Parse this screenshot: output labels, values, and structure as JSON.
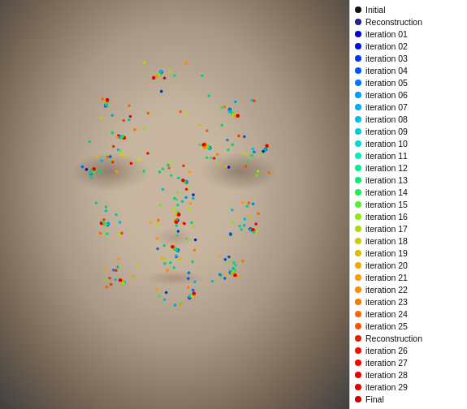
{
  "legend": {
    "items": [
      {
        "label": "Initial",
        "color": "#111111"
      },
      {
        "label": "Reconstruction",
        "color": "#222288"
      },
      {
        "label": "iteration 01",
        "color": "#0000cc"
      },
      {
        "label": "iteration 02",
        "color": "#0011dd"
      },
      {
        "label": "iteration 03",
        "color": "#0033ee"
      },
      {
        "label": "iteration 04",
        "color": "#0055ff"
      },
      {
        "label": "iteration 05",
        "color": "#0077ff"
      },
      {
        "label": "iteration 06",
        "color": "#0099ff"
      },
      {
        "label": "iteration 07",
        "color": "#00aaff"
      },
      {
        "label": "iteration 08",
        "color": "#00bbee"
      },
      {
        "label": "iteration 09",
        "color": "#00ccdd"
      },
      {
        "label": "iteration 10",
        "color": "#00ddcc"
      },
      {
        "label": "iteration 11",
        "color": "#00eebb"
      },
      {
        "label": "iteration 12",
        "color": "#00ee99"
      },
      {
        "label": "iteration 13",
        "color": "#00ee77"
      },
      {
        "label": "iteration 14",
        "color": "#22ee55"
      },
      {
        "label": "iteration 15",
        "color": "#55ee33"
      },
      {
        "label": "iteration 16",
        "color": "#88ee11"
      },
      {
        "label": "iteration 17",
        "color": "#aadd00"
      },
      {
        "label": "iteration 18",
        "color": "#cccc00"
      },
      {
        "label": "iteration 19",
        "color": "#ddbb00"
      },
      {
        "label": "iteration 20",
        "color": "#eeaa00"
      },
      {
        "label": "iteration 21",
        "color": "#ff9900"
      },
      {
        "label": "iteration 22",
        "color": "#ff8800"
      },
      {
        "label": "iteration 23",
        "color": "#ff7700"
      },
      {
        "label": "iteration 24",
        "color": "#ff6600"
      },
      {
        "label": "iteration 25",
        "color": "#ff5500"
      },
      {
        "label": "Reconstruction",
        "color": "#dd2200"
      },
      {
        "label": "iteration 26",
        "color": "#ee1100"
      },
      {
        "label": "iteration 27",
        "color": "#ff0000"
      },
      {
        "label": "iteration 28",
        "color": "#ee0000"
      },
      {
        "label": "iteration 29",
        "color": "#dd0000"
      },
      {
        "label": "Final",
        "color": "#cc0000"
      }
    ]
  }
}
